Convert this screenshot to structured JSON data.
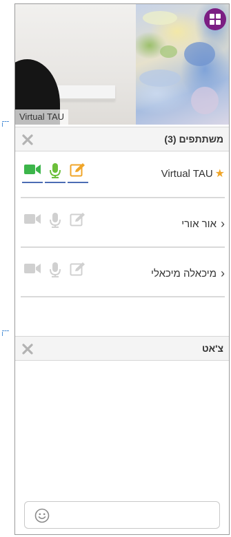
{
  "video": {
    "participant_label": "Virtual TAU",
    "layout_button_icon": "grid-layout-icon"
  },
  "participants": {
    "title": "משתתפים (3)",
    "close_icon": "close-icon",
    "items": [
      {
        "name": "Virtual TAU",
        "is_host": true,
        "media_active": true
      },
      {
        "name": "אור אורי",
        "is_host": false,
        "media_active": false
      },
      {
        "name": "מיכאלה מיכאלי",
        "is_host": false,
        "media_active": false
      }
    ]
  },
  "chat": {
    "title": "צ'אט",
    "close_icon": "close-icon",
    "input_value": "",
    "emoji_icon": "smiley-icon"
  },
  "colors": {
    "accent_purple": "#7b1e83",
    "video_active": "#3cb54a",
    "mic_active": "#6cbf3a",
    "edit_active": "#f0a528",
    "icon_inactive": "#d0d0d0",
    "host_star": "#f0a528"
  }
}
